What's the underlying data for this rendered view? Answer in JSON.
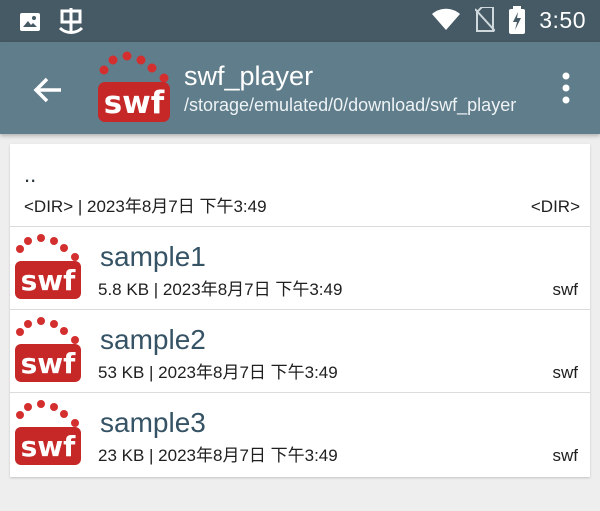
{
  "status_bar": {
    "time": "3:50",
    "icons": [
      "image-icon",
      "bug-icon",
      "wifi-icon",
      "no-sim-icon",
      "battery-charging-icon"
    ]
  },
  "toolbar": {
    "title": "swf_player",
    "path": "/storage/emulated/0/download/swf_player",
    "logo_text": "swf"
  },
  "parent_dir": {
    "name": "..",
    "meta": "<DIR> | 2023年8月7日 下午3:49",
    "type": "<DIR>"
  },
  "files": [
    {
      "name": "sample1",
      "meta": "5.8 KB | 2023年8月7日 下午3:49",
      "type": "swf",
      "icon_text": "swf"
    },
    {
      "name": "sample2",
      "meta": "53 KB | 2023年8月7日 下午3:49",
      "type": "swf",
      "icon_text": "swf"
    },
    {
      "name": "sample3",
      "meta": "23 KB | 2023年8月7日 下午3:49",
      "type": "swf",
      "icon_text": "swf"
    }
  ],
  "colors": {
    "status_bar": "#455a64",
    "toolbar": "#607d8b",
    "logo_red": "#c62828"
  }
}
